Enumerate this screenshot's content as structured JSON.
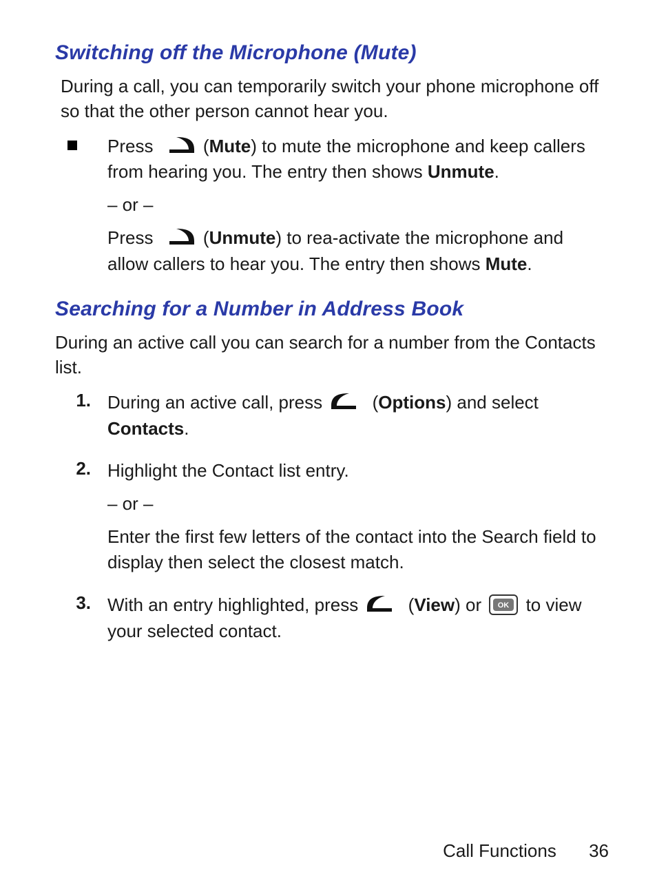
{
  "section1": {
    "heading": "Switching off the Microphone (Mute)",
    "intro": "During a call, you can temporarily switch your phone microphone off so that the other person cannot hear you.",
    "bullet": {
      "press1": "Press ",
      "label1_open": " (",
      "label1_bold": "Mute",
      "label1_rest": ") to mute the microphone and keep callers from hearing you. The entry then shows ",
      "bold1": "Unmute",
      "end1": ".",
      "or": "– or –",
      "press2": "Press ",
      "label2_open": " (",
      "label2_bold": "Unmute",
      "label2_rest": ") to rea-activate the microphone and allow callers to hear you. The entry then shows ",
      "bold2": "Mute",
      "end2": "."
    }
  },
  "section2": {
    "heading": "Searching for a Number in Address Book",
    "intro": "During an active call you can search for a number from the Contacts list.",
    "steps": {
      "n1": "1.",
      "s1a": "During an active call, press ",
      "s1b_open": " (",
      "s1b_bold": "Options",
      "s1b_rest": ") and select ",
      "s1c_bold": "Contacts",
      "s1c_end": ".",
      "n2": "2.",
      "s2a": "Highlight the Contact list entry.",
      "s2or": "– or –",
      "s2b": "Enter the first few letters of the contact into the Search field to display then select the closest match.",
      "n3": "3.",
      "s3a": "With an entry highlighted, press ",
      "s3b_open": " (",
      "s3b_bold": "View",
      "s3b_rest": ") or ",
      "s3c": " to view your selected contact."
    }
  },
  "footer": {
    "chapter": "Call Functions",
    "page": "36"
  }
}
